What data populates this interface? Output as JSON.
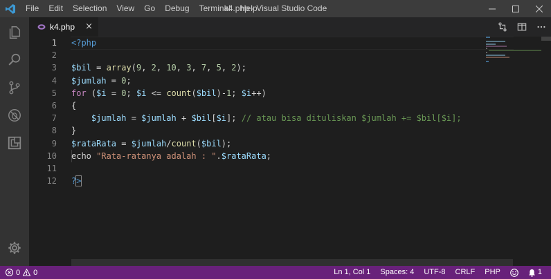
{
  "window": {
    "title": "k4.php - Visual Studio Code"
  },
  "menu": [
    "File",
    "Edit",
    "Selection",
    "View",
    "Go",
    "Debug",
    "Terminal",
    "Help"
  ],
  "tab": {
    "label": "k4.php",
    "close": "×"
  },
  "line_numbers": [
    "1",
    "2",
    "3",
    "4",
    "5",
    "6",
    "7",
    "8",
    "9",
    "10",
    "11",
    "12"
  ],
  "code": {
    "l1_open": "<?php",
    "l3_var": "$bil",
    "l3_eq": " = ",
    "l3_fn": "array",
    "l3_open": "(",
    "l3_n1": "9",
    "l3_n2": "2",
    "l3_n3": "10",
    "l3_n4": "3",
    "l3_n5": "7",
    "l3_n6": "5",
    "l3_n7": "2",
    "l3_sep": ", ",
    "l3_close": ");",
    "l4_var": "$jumlah",
    "l4_eq": " = ",
    "l4_num": "0",
    "l4_end": ";",
    "l5_kw": "for",
    "l5_a": " (",
    "l5_var1": "$i",
    "l5_b": " = ",
    "l5_num0": "0",
    "l5_c": "; ",
    "l5_var2": "$i",
    "l5_d": " <= ",
    "l5_fn": "count",
    "l5_e": "(",
    "l5_var3": "$bil",
    "l5_f": ")-",
    "l5_num1": "1",
    "l5_g": "; ",
    "l5_var4": "$i",
    "l5_h": "++)",
    "l6_brace": "{",
    "l7_indent": "    ",
    "l7_var1": "$jumlah",
    "l7_a": " = ",
    "l7_var2": "$jumlah",
    "l7_b": " + ",
    "l7_var3": "$bil",
    "l7_c": "[",
    "l7_var4": "$i",
    "l7_d": "]; ",
    "l7_cmt": "// atau bisa dituliskan $jumlah += $bil[$i];",
    "l8_brace": "}",
    "l9_var1": "$rataRata",
    "l9_a": " = ",
    "l9_var2": "$jumlah",
    "l9_b": "/",
    "l9_fn": "count",
    "l9_c": "(",
    "l9_var3": "$bil",
    "l9_d": ");",
    "l10_kw": "echo",
    "l10_a": " ",
    "l10_str": "\"Rata-ratanya adalah : \"",
    "l10_b": ".",
    "l10_var": "$rataRata",
    "l10_c": ";",
    "l12_q": "?",
    "l12_gt": ">"
  },
  "status": {
    "errors": "0",
    "warnings": "0",
    "position": "Ln 1, Col 1",
    "spaces": "Spaces: 4",
    "encoding": "UTF-8",
    "eol": "CRLF",
    "language": "PHP",
    "notifications": "1"
  },
  "colors": {
    "statusbar": "#68217a",
    "titlebar": "#3c3c3c",
    "activitybar": "#333333",
    "editor": "#1e1e1e"
  }
}
